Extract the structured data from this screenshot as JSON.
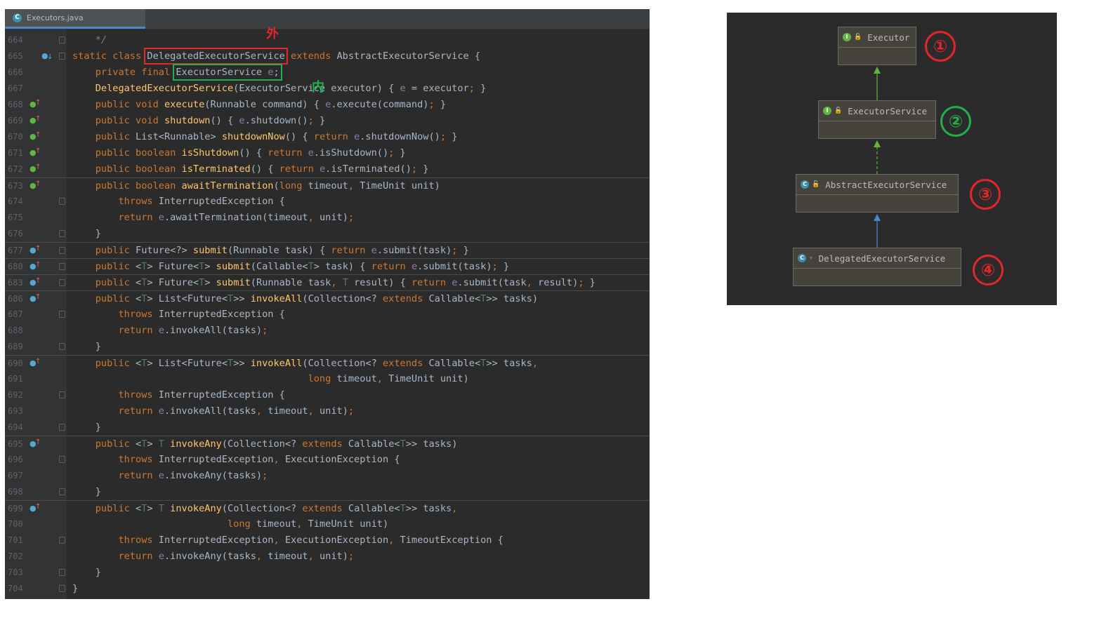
{
  "editor": {
    "tab": {
      "file_name": "Executors.java",
      "icon": "class-c-icon"
    },
    "annotations": {
      "outer_label": "外",
      "inner_label": "内"
    },
    "lines": [
      {
        "n": "664",
        "fold": true,
        "mark": "",
        "html": "    <span class=\"cm\">*/</span>"
      },
      {
        "n": "665",
        "fold": true,
        "mark": "down",
        "html": "<span class=\"kw\">static class </span><span class=\"hl-red\">DelegatedExecutorService</span><span class=\"kw\"> extends </span>AbstractExecutorService {"
      },
      {
        "n": "666",
        "fold": false,
        "mark": "",
        "html": "    <span class=\"kw\">private final </span><span class=\"hl-green\">ExecutorService <span class=\"fld\">e</span>;</span>"
      },
      {
        "n": "667",
        "fold": false,
        "mark": "",
        "html": "    <span class=\"fn\">DelegatedExecutorService</span>(ExecutorService executor) { <span class=\"fld\">e</span> = executor<span class=\"kw\">;</span> }"
      },
      {
        "n": "668",
        "fold": false,
        "mark": "up-green",
        "html": "    <span class=\"kw\">public void </span><span class=\"fn\">execute</span>(Runnable command) { <span class=\"fld\">e</span>.execute(command)<span class=\"kw\">;</span> }"
      },
      {
        "n": "669",
        "fold": false,
        "mark": "up-green",
        "html": "    <span class=\"kw\">public void </span><span class=\"fn\">shutdown</span>() { <span class=\"fld\">e</span>.shutdown()<span class=\"kw\">;</span> }"
      },
      {
        "n": "670",
        "fold": false,
        "mark": "up-green",
        "html": "    <span class=\"kw\">public </span>List&lt;Runnable&gt; <span class=\"fn\">shutdownNow</span>() { <span class=\"kw\">return </span><span class=\"fld\">e</span>.shutdownNow()<span class=\"kw\">;</span> }"
      },
      {
        "n": "671",
        "fold": false,
        "mark": "up-green",
        "html": "    <span class=\"kw\">public boolean </span><span class=\"fn\">isShutdown</span>() { <span class=\"kw\">return </span><span class=\"fld\">e</span>.isShutdown()<span class=\"kw\">;</span> }"
      },
      {
        "n": "672",
        "fold": false,
        "mark": "up-green",
        "html": "    <span class=\"kw\">public boolean </span><span class=\"fn\">isTerminated</span>() { <span class=\"kw\">return </span><span class=\"fld\">e</span>.isTerminated()<span class=\"kw\">;</span> }"
      },
      {
        "n": "673",
        "fold": false,
        "mark": "up-green",
        "sep": true,
        "html": "    <span class=\"kw\">public boolean </span><span class=\"fn\">awaitTermination</span>(<span class=\"kw\">long </span>timeout<span class=\"kw\">, </span>TimeUnit unit)"
      },
      {
        "n": "674",
        "fold": true,
        "mark": "",
        "html": "        <span class=\"kw\">throws </span>InterruptedException {"
      },
      {
        "n": "675",
        "fold": false,
        "mark": "",
        "html": "        <span class=\"kw\">return </span><span class=\"fld\">e</span>.awaitTermination(timeout<span class=\"kw\">, </span>unit)<span class=\"kw\">;</span>"
      },
      {
        "n": "676",
        "fold": true,
        "mark": "",
        "html": "    }"
      },
      {
        "n": "677",
        "fold": true,
        "mark": "up-blue",
        "sep": true,
        "html": "    <span class=\"kw\">public </span>Future&lt;?&gt; <span class=\"fn\">submit</span>(Runnable task) { <span class=\"kw\">return </span><span class=\"fld\">e</span>.submit(task)<span class=\"kw\">;</span> }"
      },
      {
        "n": "680",
        "fold": true,
        "mark": "up-blue",
        "sep": true,
        "html": "    <span class=\"kw\">public </span>&lt;<span class=\"gen\">T</span>&gt; Future&lt;<span class=\"gen\">T</span>&gt; <span class=\"fn\">submit</span>(Callable&lt;<span class=\"gen\">T</span>&gt; task) { <span class=\"kw\">return </span><span class=\"fld\">e</span>.submit(task)<span class=\"kw\">;</span> }"
      },
      {
        "n": "683",
        "fold": true,
        "mark": "up-blue",
        "sep": true,
        "html": "    <span class=\"kw\">public </span>&lt;<span class=\"gen\">T</span>&gt; Future&lt;<span class=\"gen\">T</span>&gt; <span class=\"fn\">submit</span>(Runnable task<span class=\"kw\">, </span><span class=\"gen\">T</span> result) { <span class=\"kw\">return </span><span class=\"fld\">e</span>.submit(task<span class=\"kw\">, </span>result)<span class=\"kw\">;</span> }"
      },
      {
        "n": "686",
        "fold": false,
        "mark": "up-blue",
        "sep": true,
        "html": "    <span class=\"kw\">public </span>&lt;<span class=\"gen\">T</span>&gt; List&lt;Future&lt;<span class=\"gen\">T</span>&gt;&gt; <span class=\"fn\">invokeAll</span>(Collection&lt;? <span class=\"kw\">extends </span>Callable&lt;<span class=\"gen\">T</span>&gt;&gt; tasks)"
      },
      {
        "n": "687",
        "fold": true,
        "mark": "",
        "html": "        <span class=\"kw\">throws </span>InterruptedException {"
      },
      {
        "n": "688",
        "fold": false,
        "mark": "",
        "html": "        <span class=\"kw\">return </span><span class=\"fld\">e</span>.invokeAll(tasks)<span class=\"kw\">;</span>"
      },
      {
        "n": "689",
        "fold": true,
        "mark": "",
        "html": "    }"
      },
      {
        "n": "690",
        "fold": false,
        "mark": "up-blue",
        "sep": true,
        "html": "    <span class=\"kw\">public </span>&lt;<span class=\"gen\">T</span>&gt; List&lt;Future&lt;<span class=\"gen\">T</span>&gt;&gt; <span class=\"fn\">invokeAll</span>(Collection&lt;? <span class=\"kw\">extends </span>Callable&lt;<span class=\"gen\">T</span>&gt;&gt; tasks<span class=\"kw\">,</span>"
      },
      {
        "n": "691",
        "fold": false,
        "mark": "",
        "html": "                                         <span class=\"kw\">long </span>timeout<span class=\"kw\">, </span>TimeUnit unit)"
      },
      {
        "n": "692",
        "fold": true,
        "mark": "",
        "html": "        <span class=\"kw\">throws </span>InterruptedException {"
      },
      {
        "n": "693",
        "fold": false,
        "mark": "",
        "html": "        <span class=\"kw\">return </span><span class=\"fld\">e</span>.invokeAll(tasks<span class=\"kw\">, </span>timeout<span class=\"kw\">, </span>unit)<span class=\"kw\">;</span>"
      },
      {
        "n": "694",
        "fold": true,
        "mark": "",
        "html": "    }"
      },
      {
        "n": "695",
        "fold": false,
        "mark": "up-blue",
        "sep": true,
        "html": "    <span class=\"kw\">public </span>&lt;<span class=\"gen\">T</span>&gt; <span class=\"gen\">T</span> <span class=\"fn\">invokeAny</span>(Collection&lt;? <span class=\"kw\">extends </span>Callable&lt;<span class=\"gen\">T</span>&gt;&gt; tasks)"
      },
      {
        "n": "696",
        "fold": true,
        "mark": "",
        "html": "        <span class=\"kw\">throws </span>InterruptedException<span class=\"kw\">, </span>ExecutionException {"
      },
      {
        "n": "697",
        "fold": false,
        "mark": "",
        "html": "        <span class=\"kw\">return </span><span class=\"fld\">e</span>.invokeAny(tasks)<span class=\"kw\">;</span>"
      },
      {
        "n": "698",
        "fold": true,
        "mark": "",
        "html": "    }"
      },
      {
        "n": "699",
        "fold": false,
        "mark": "up-blue",
        "sep": true,
        "html": "    <span class=\"kw\">public </span>&lt;<span class=\"gen\">T</span>&gt; <span class=\"gen\">T</span> <span class=\"fn\">invokeAny</span>(Collection&lt;? <span class=\"kw\">extends </span>Callable&lt;<span class=\"gen\">T</span>&gt;&gt; tasks<span class=\"kw\">,</span>"
      },
      {
        "n": "700",
        "fold": false,
        "mark": "",
        "html": "                           <span class=\"kw\">long </span>timeout<span class=\"kw\">, </span>TimeUnit unit)"
      },
      {
        "n": "701",
        "fold": true,
        "mark": "",
        "html": "        <span class=\"kw\">throws </span>InterruptedException<span class=\"kw\">, </span>ExecutionException<span class=\"kw\">, </span>TimeoutException {"
      },
      {
        "n": "702",
        "fold": false,
        "mark": "",
        "html": "        <span class=\"kw\">return </span><span class=\"fld\">e</span>.invokeAny(tasks<span class=\"kw\">, </span>timeout<span class=\"kw\">, </span>unit)<span class=\"kw\">;</span>"
      },
      {
        "n": "703",
        "fold": true,
        "mark": "",
        "html": "    }"
      },
      {
        "n": "704",
        "fold": true,
        "mark": "",
        "html": "}"
      }
    ]
  },
  "diagram": {
    "nodes": [
      {
        "name": "Executor",
        "icon": "interface-icon",
        "badge": "①",
        "badge_color": "#e4262a"
      },
      {
        "name": "ExecutorService",
        "icon": "interface-icon",
        "badge": "②",
        "badge_color": "#20b14a"
      },
      {
        "name": "AbstractExecutorService",
        "icon": "abstract-class-icon",
        "badge": "③",
        "badge_color": "#e4262a"
      },
      {
        "name": "DelegatedExecutorService",
        "icon": "class-icon",
        "badge": "④",
        "badge_color": "#e4262a"
      }
    ],
    "edges": [
      {
        "from": "ExecutorService",
        "to": "Executor",
        "kind": "extends",
        "color": "#62b543"
      },
      {
        "from": "AbstractExecutorService",
        "to": "ExecutorService",
        "kind": "implements",
        "color": "#62b543"
      },
      {
        "from": "DelegatedExecutorService",
        "to": "AbstractExecutorService",
        "kind": "extends",
        "color": "#4a88c7"
      }
    ]
  },
  "colors": {
    "keyword": "#cc7832",
    "method": "#ffc66d",
    "field": "#9876aa",
    "highlight_red": "#e4262a",
    "highlight_green": "#20b14a"
  }
}
